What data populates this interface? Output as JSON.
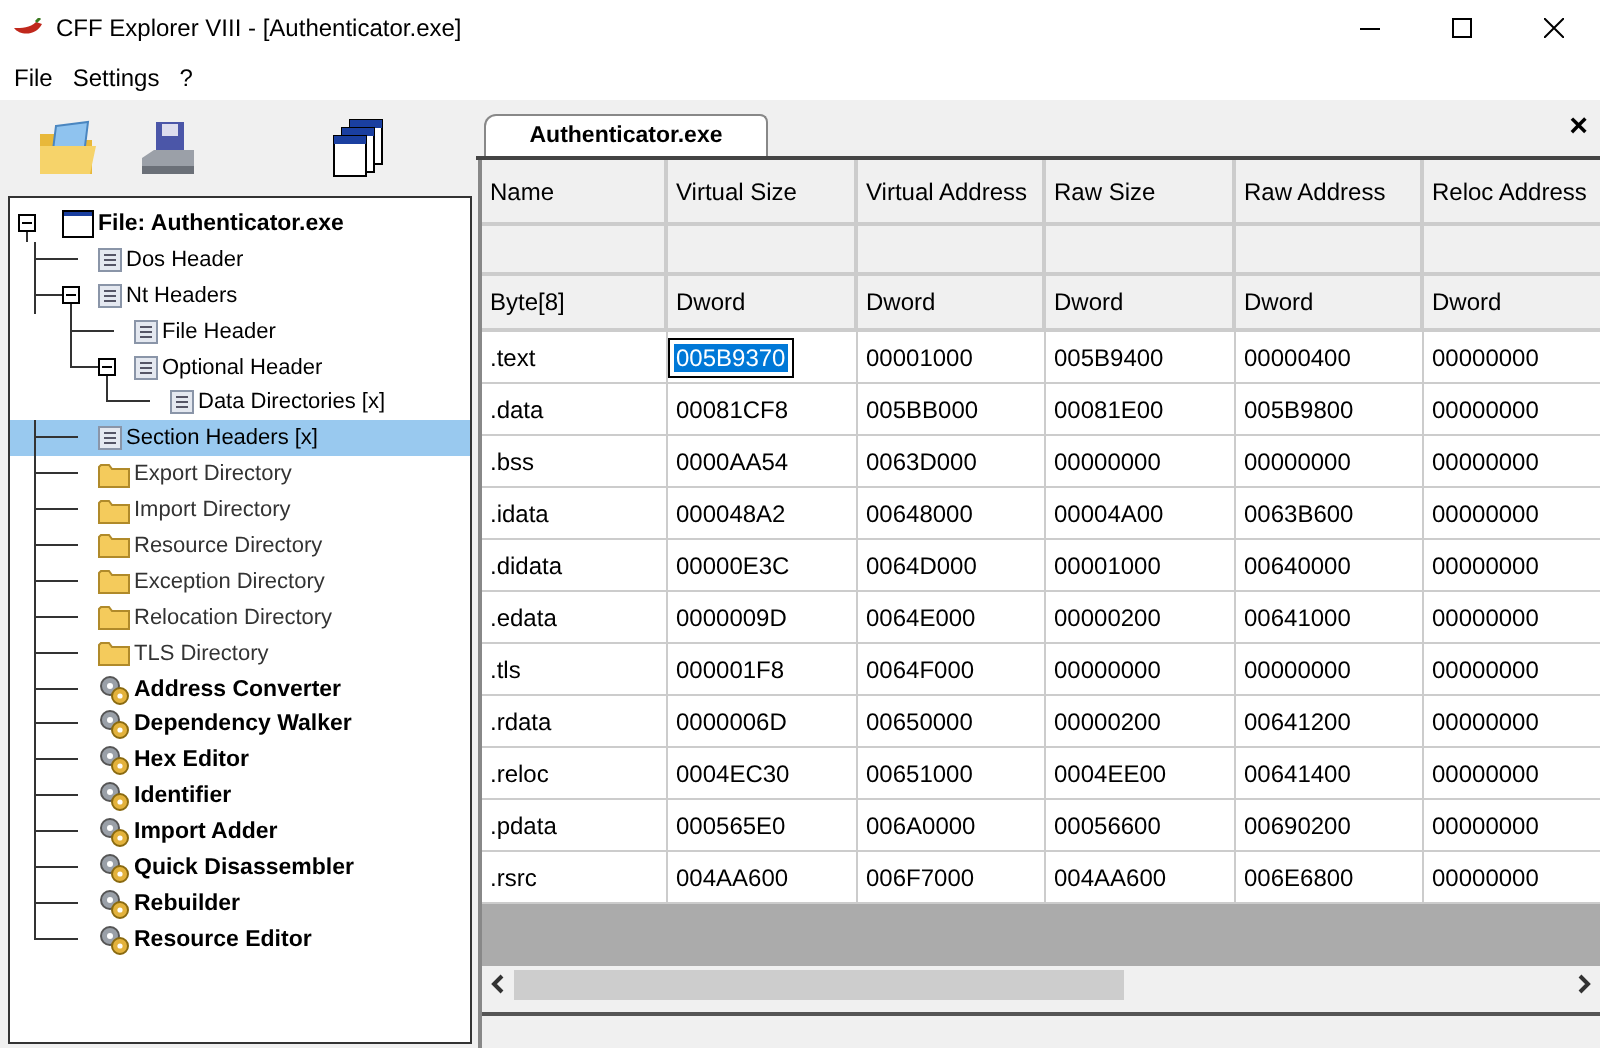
{
  "window": {
    "title": "CFF Explorer VIII - [Authenticator.exe]"
  },
  "menu": [
    "File",
    "Settings",
    "?"
  ],
  "tree": {
    "label": "File: Authenticator.exe",
    "kind": "file",
    "selected": false,
    "expanded": true,
    "children": [
      {
        "label": "Dos Header",
        "kind": "doc",
        "selected": false
      },
      {
        "label": "Nt Headers",
        "kind": "doc",
        "selected": false,
        "expanded": true,
        "children": [
          {
            "label": "File Header",
            "kind": "doc",
            "selected": false
          },
          {
            "label": "Optional Header",
            "kind": "doc",
            "selected": false,
            "expanded": true,
            "children": [
              {
                "label": "Data Directories [x]",
                "kind": "doc",
                "selected": false
              }
            ]
          }
        ]
      },
      {
        "label": "Section Headers [x]",
        "kind": "doc",
        "selected": true
      },
      {
        "label": "Export Directory",
        "kind": "folder",
        "selected": false
      },
      {
        "label": "Import Directory",
        "kind": "folder",
        "selected": false
      },
      {
        "label": "Resource Directory",
        "kind": "folder",
        "selected": false
      },
      {
        "label": "Exception Directory",
        "kind": "folder",
        "selected": false
      },
      {
        "label": "Relocation Directory",
        "kind": "folder",
        "selected": false
      },
      {
        "label": "TLS Directory",
        "kind": "folder",
        "selected": false
      },
      {
        "label": "Address Converter",
        "kind": "tool",
        "selected": false
      },
      {
        "label": "Dependency Walker",
        "kind": "tool",
        "selected": false
      },
      {
        "label": "Hex Editor",
        "kind": "tool",
        "selected": false
      },
      {
        "label": "Identifier",
        "kind": "tool",
        "selected": false
      },
      {
        "label": "Import Adder",
        "kind": "tool",
        "selected": false
      },
      {
        "label": "Quick Disassembler",
        "kind": "tool",
        "selected": false
      },
      {
        "label": "Rebuilder",
        "kind": "tool",
        "selected": false
      },
      {
        "label": "Resource Editor",
        "kind": "tool",
        "selected": false
      }
    ]
  },
  "tab": {
    "label": "Authenticator.exe",
    "selected": true,
    "close": "×"
  },
  "table": {
    "columns": [
      "Name",
      "Virtual Size",
      "Virtual Address",
      "Raw Size",
      "Raw Address",
      "Reloc Address"
    ],
    "types": [
      "Byte[8]",
      "Dword",
      "Dword",
      "Dword",
      "Dword",
      "Dword"
    ],
    "rows": [
      {
        "cells": [
          {
            "text": ".text",
            "selected": false
          },
          {
            "text": "005B9370",
            "selected": true
          },
          {
            "text": "00001000",
            "selected": false
          },
          {
            "text": "005B9400",
            "selected": false
          },
          {
            "text": "00000400",
            "selected": false
          },
          {
            "text": "00000000",
            "selected": false
          }
        ]
      },
      {
        "cells": [
          {
            "text": ".data",
            "selected": false
          },
          {
            "text": "00081CF8",
            "selected": false
          },
          {
            "text": "005BB000",
            "selected": false
          },
          {
            "text": "00081E00",
            "selected": false
          },
          {
            "text": "005B9800",
            "selected": false
          },
          {
            "text": "00000000",
            "selected": false
          }
        ]
      },
      {
        "cells": [
          {
            "text": ".bss",
            "selected": false
          },
          {
            "text": "0000AA54",
            "selected": false
          },
          {
            "text": "0063D000",
            "selected": false
          },
          {
            "text": "00000000",
            "selected": false
          },
          {
            "text": "00000000",
            "selected": false
          },
          {
            "text": "00000000",
            "selected": false
          }
        ]
      },
      {
        "cells": [
          {
            "text": ".idata",
            "selected": false
          },
          {
            "text": "000048A2",
            "selected": false
          },
          {
            "text": "00648000",
            "selected": false
          },
          {
            "text": "00004A00",
            "selected": false
          },
          {
            "text": "0063B600",
            "selected": false
          },
          {
            "text": "00000000",
            "selected": false
          }
        ]
      },
      {
        "cells": [
          {
            "text": ".didata",
            "selected": false
          },
          {
            "text": "00000E3C",
            "selected": false
          },
          {
            "text": "0064D000",
            "selected": false
          },
          {
            "text": "00001000",
            "selected": false
          },
          {
            "text": "00640000",
            "selected": false
          },
          {
            "text": "00000000",
            "selected": false
          }
        ]
      },
      {
        "cells": [
          {
            "text": ".edata",
            "selected": false
          },
          {
            "text": "0000009D",
            "selected": false
          },
          {
            "text": "0064E000",
            "selected": false
          },
          {
            "text": "00000200",
            "selected": false
          },
          {
            "text": "00641000",
            "selected": false
          },
          {
            "text": "00000000",
            "selected": false
          }
        ]
      },
      {
        "cells": [
          {
            "text": ".tls",
            "selected": false
          },
          {
            "text": "000001F8",
            "selected": false
          },
          {
            "text": "0064F000",
            "selected": false
          },
          {
            "text": "00000000",
            "selected": false
          },
          {
            "text": "00000000",
            "selected": false
          },
          {
            "text": "00000000",
            "selected": false
          }
        ]
      },
      {
        "cells": [
          {
            "text": ".rdata",
            "selected": false
          },
          {
            "text": "0000006D",
            "selected": false
          },
          {
            "text": "00650000",
            "selected": false
          },
          {
            "text": "00000200",
            "selected": false
          },
          {
            "text": "00641200",
            "selected": false
          },
          {
            "text": "00000000",
            "selected": false
          }
        ]
      },
      {
        "cells": [
          {
            "text": ".reloc",
            "selected": false
          },
          {
            "text": "0004EC30",
            "selected": false
          },
          {
            "text": "00651000",
            "selected": false
          },
          {
            "text": "0004EE00",
            "selected": false
          },
          {
            "text": "00641400",
            "selected": false
          },
          {
            "text": "00000000",
            "selected": false
          }
        ]
      },
      {
        "cells": [
          {
            "text": ".pdata",
            "selected": false
          },
          {
            "text": "000565E0",
            "selected": false
          },
          {
            "text": "006A0000",
            "selected": false
          },
          {
            "text": "00056600",
            "selected": false
          },
          {
            "text": "00690200",
            "selected": false
          },
          {
            "text": "00000000",
            "selected": false
          }
        ]
      },
      {
        "cells": [
          {
            "text": ".rsrc",
            "selected": false
          },
          {
            "text": "004AA600",
            "selected": false
          },
          {
            "text": "006F7000",
            "selected": false
          },
          {
            "text": "004AA600",
            "selected": false
          },
          {
            "text": "006E6800",
            "selected": false
          },
          {
            "text": "00000000",
            "selected": false
          }
        ]
      }
    ]
  }
}
